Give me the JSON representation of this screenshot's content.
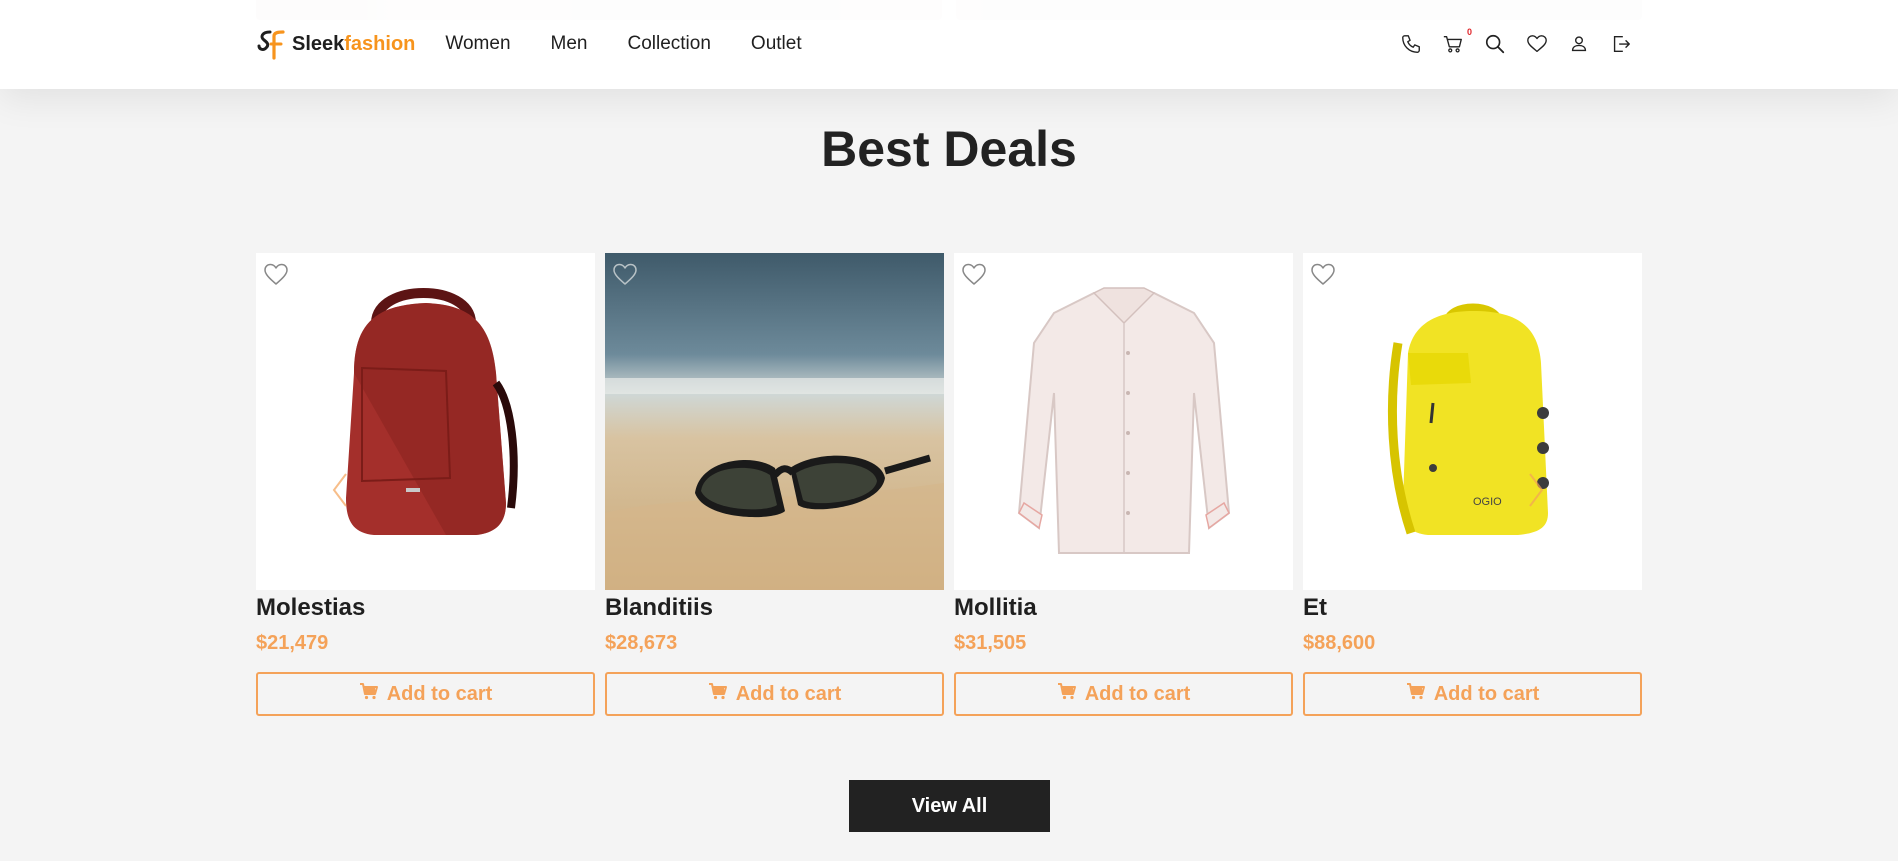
{
  "brand": {
    "name_part1": "Sleek",
    "name_part2": "fashion",
    "accent": "#f7941d"
  },
  "nav": [
    {
      "label": "Women"
    },
    {
      "label": "Men"
    },
    {
      "label": "Collection"
    },
    {
      "label": "Outlet"
    }
  ],
  "header_actions": {
    "icons": [
      "phone-icon",
      "cart-icon",
      "search-icon",
      "heart-icon",
      "user-icon",
      "logout-icon"
    ],
    "cart_count": "0"
  },
  "section": {
    "title": "Best Deals"
  },
  "products": [
    {
      "name": "Molestias",
      "price": "$21,479",
      "image": "red-backpack"
    },
    {
      "name": "Blanditiis",
      "price": "$28,673",
      "image": "sunglasses-on-beach"
    },
    {
      "name": "Mollitia",
      "price": "$31,505",
      "image": "white-shirt"
    },
    {
      "name": "Et",
      "price": "$88,600",
      "image": "yellow-backpack"
    }
  ],
  "add_to_cart_label": "Add to cart",
  "view_all_label": "View All",
  "colors": {
    "price": "#f4a259",
    "button_border": "#f4a259",
    "dark": "#222222",
    "background": "#f4f4f4"
  }
}
